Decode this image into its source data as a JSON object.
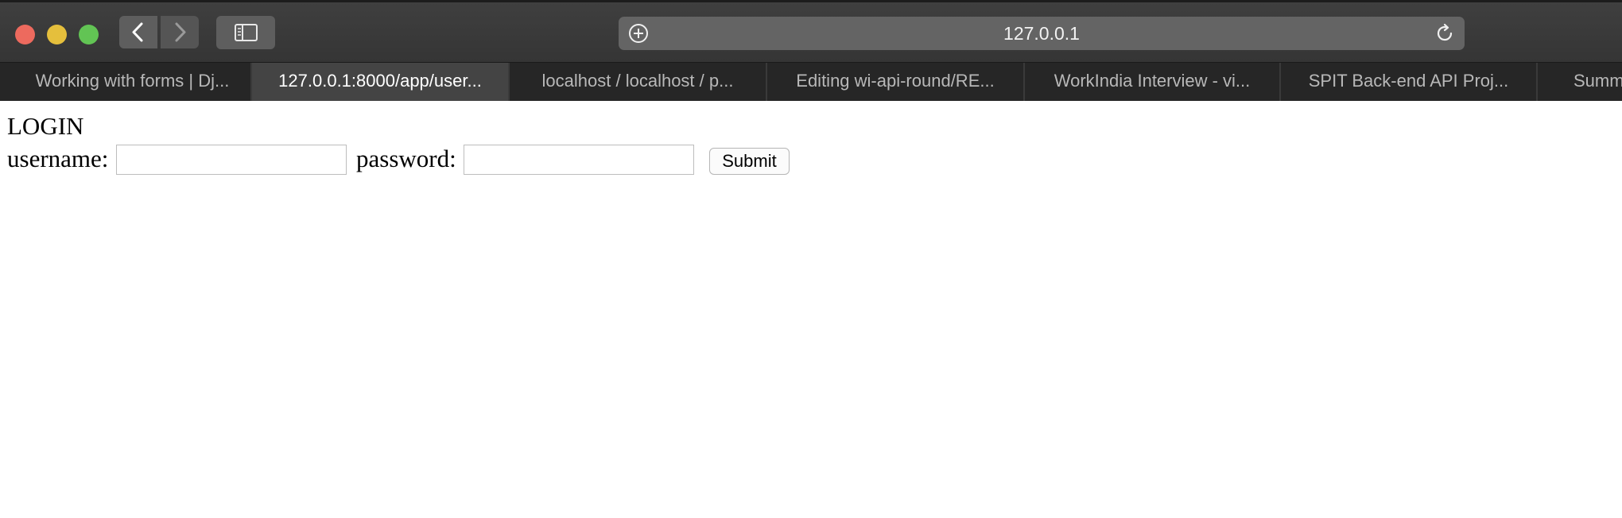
{
  "window": {
    "address_text": "127.0.0.1"
  },
  "icons": {
    "back": "chevron-left-icon",
    "forward": "chevron-right-icon",
    "sidebar": "sidebar-icon",
    "add": "plus-circle-icon",
    "reload": "reload-icon"
  },
  "tabs": [
    {
      "label": "Working with forms | Dj...",
      "active": false
    },
    {
      "label": "127.0.0.1:8000/app/user...",
      "active": true
    },
    {
      "label": "localhost / localhost / p...",
      "active": false
    },
    {
      "label": "Editing wi-api-round/RE...",
      "active": false
    },
    {
      "label": "WorkIndia Interview - vi...",
      "active": false
    },
    {
      "label": "SPIT Back-end API Proj...",
      "active": false
    },
    {
      "label": "Summ",
      "active": false
    }
  ],
  "page": {
    "heading": "LOGIN",
    "username_label": "username:",
    "username_value": "",
    "password_label": "password:",
    "password_value": "",
    "submit_label": "Submit"
  },
  "colors": {
    "close": "#ed6a5e",
    "minimize": "#e5bf3c",
    "maximize": "#62c454"
  }
}
